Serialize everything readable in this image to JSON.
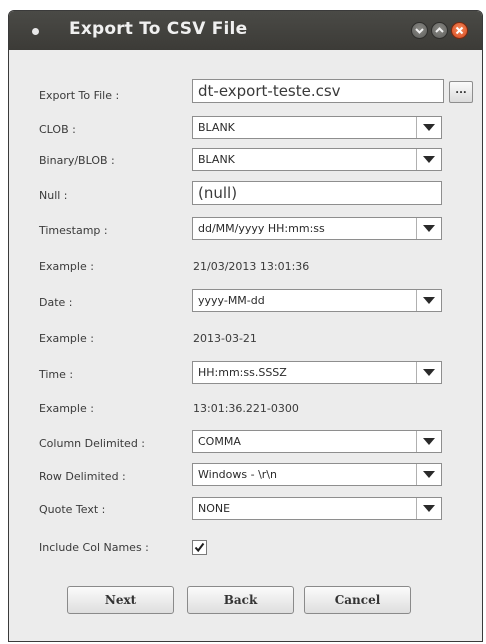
{
  "window": {
    "title": "Export To CSV File"
  },
  "form": {
    "export_to_file": {
      "label": "Export To File :",
      "value": "dt-export-teste.csv",
      "browse_label": "..."
    },
    "clob": {
      "label": "CLOB :",
      "value": "BLANK"
    },
    "blob": {
      "label": "Binary/BLOB :",
      "value": "BLANK"
    },
    "null": {
      "label": "Null :",
      "value": "(null)"
    },
    "timestamp": {
      "label": "Timestamp :",
      "value": "dd/MM/yyyy HH:mm:ss"
    },
    "timestamp_example": {
      "label": "Example :",
      "value": "21/03/2013 13:01:36"
    },
    "date": {
      "label": "Date :",
      "value": "yyyy-MM-dd"
    },
    "date_example": {
      "label": "Example :",
      "value": "2013-03-21"
    },
    "time": {
      "label": "Time :",
      "value": "HH:mm:ss.SSSZ"
    },
    "time_example": {
      "label": "Example :",
      "value": "13:01:36.221-0300"
    },
    "column_delimited": {
      "label": "Column Delimited :",
      "value": "COMMA"
    },
    "row_delimited": {
      "label": "Row Delimited :",
      "value": "Windows - \\r\\n"
    },
    "quote_text": {
      "label": "Quote Text :",
      "value": "NONE"
    },
    "include_col_names": {
      "label": "Include Col Names :",
      "checked": true
    }
  },
  "buttons": {
    "next": "Next",
    "back": "Back",
    "cancel": "Cancel"
  },
  "colors": {
    "titlebar": "#3c3b37",
    "close_button": "#e0542a",
    "window_bg": "#ececec"
  }
}
